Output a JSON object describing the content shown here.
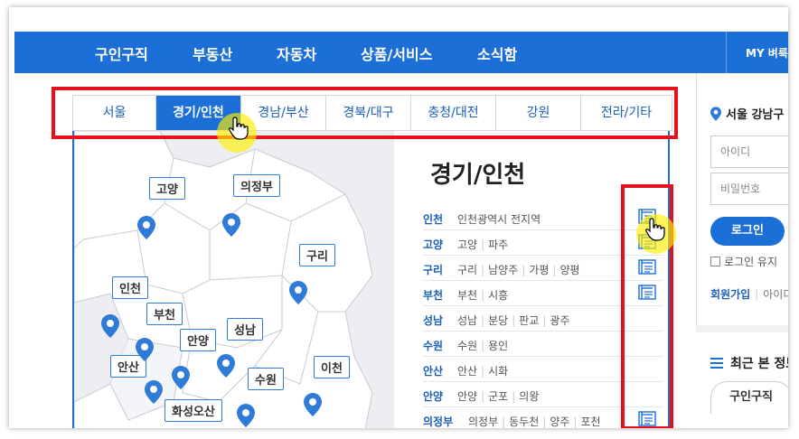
{
  "topnav": {
    "items": [
      "구인구직",
      "부동산",
      "자동차",
      "상품/서비스",
      "소식함"
    ],
    "my": "MY 벼룩"
  },
  "tabs": [
    "서울",
    "경기/인천",
    "경남/부산",
    "경북/대구",
    "충청/대전",
    "강원",
    "전라/기타"
  ],
  "active_tab": "경기/인천",
  "map": {
    "labels": [
      "고양",
      "의정부",
      "구리",
      "인천",
      "부천",
      "안양",
      "성남",
      "안산",
      "수원",
      "이천",
      "화성오산"
    ]
  },
  "region_panel": {
    "title": "경기/인천",
    "rows": [
      {
        "name": "인천",
        "subs": [
          "인천광역시 전지역"
        ]
      },
      {
        "name": "고양",
        "subs": [
          "고양",
          "파주"
        ]
      },
      {
        "name": "구리",
        "subs": [
          "구리",
          "남양주",
          "가평",
          "양평"
        ]
      },
      {
        "name": "부천",
        "subs": [
          "부천",
          "시흥"
        ]
      },
      {
        "name": "성남",
        "subs": [
          "성남",
          "분당",
          "판교",
          "광주"
        ]
      },
      {
        "name": "수원",
        "subs": [
          "수원",
          "용인"
        ]
      },
      {
        "name": "안산",
        "subs": [
          "안산",
          "시화"
        ]
      },
      {
        "name": "안양",
        "subs": [
          "안양",
          "군포",
          "의왕"
        ]
      },
      {
        "name": "의정부",
        "subs": [
          "의정부",
          "동두천",
          "양주",
          "포천"
        ]
      }
    ]
  },
  "sidebar": {
    "location": "서울 강남구",
    "id_placeholder": "아이디",
    "pw_placeholder": "비밀번호",
    "login_label": "로그인",
    "keep_login": "로그인 유지",
    "join_label": "회원가입",
    "find_id": "아이디",
    "recent_title": "최근 본 정보",
    "recent_tab": "구인구직"
  },
  "colors": {
    "brand": "#1b6fd6",
    "highlight": "#e8101b"
  }
}
